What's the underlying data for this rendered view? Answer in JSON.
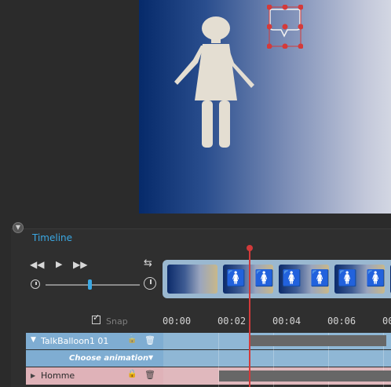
{
  "timeline": {
    "title": "Timeline",
    "snap_label": "Snap",
    "snap_checked": true,
    "speed_level": 0.47,
    "ticks": [
      "00:00",
      "00:02",
      "00:04",
      "00:06",
      "00:0"
    ]
  },
  "tracks": [
    {
      "name": "TalkBalloon1 01",
      "animation": "Choose animation"
    },
    {
      "name": "Homme"
    }
  ],
  "icons": {
    "rewind": "◀◀",
    "play": "▶",
    "forward": "▶▶",
    "loop": "⇆",
    "expand": "▼",
    "collapse": "▶",
    "lock": "🔒",
    "trash": "🗑",
    "dropdown": "▼",
    "panel_toggle": "▼"
  },
  "colors": {
    "accent": "#3aa8e4",
    "playhead": "#d23a3a",
    "track_blue": "#8fb7d5",
    "track_pink": "#e0b8bd"
  }
}
